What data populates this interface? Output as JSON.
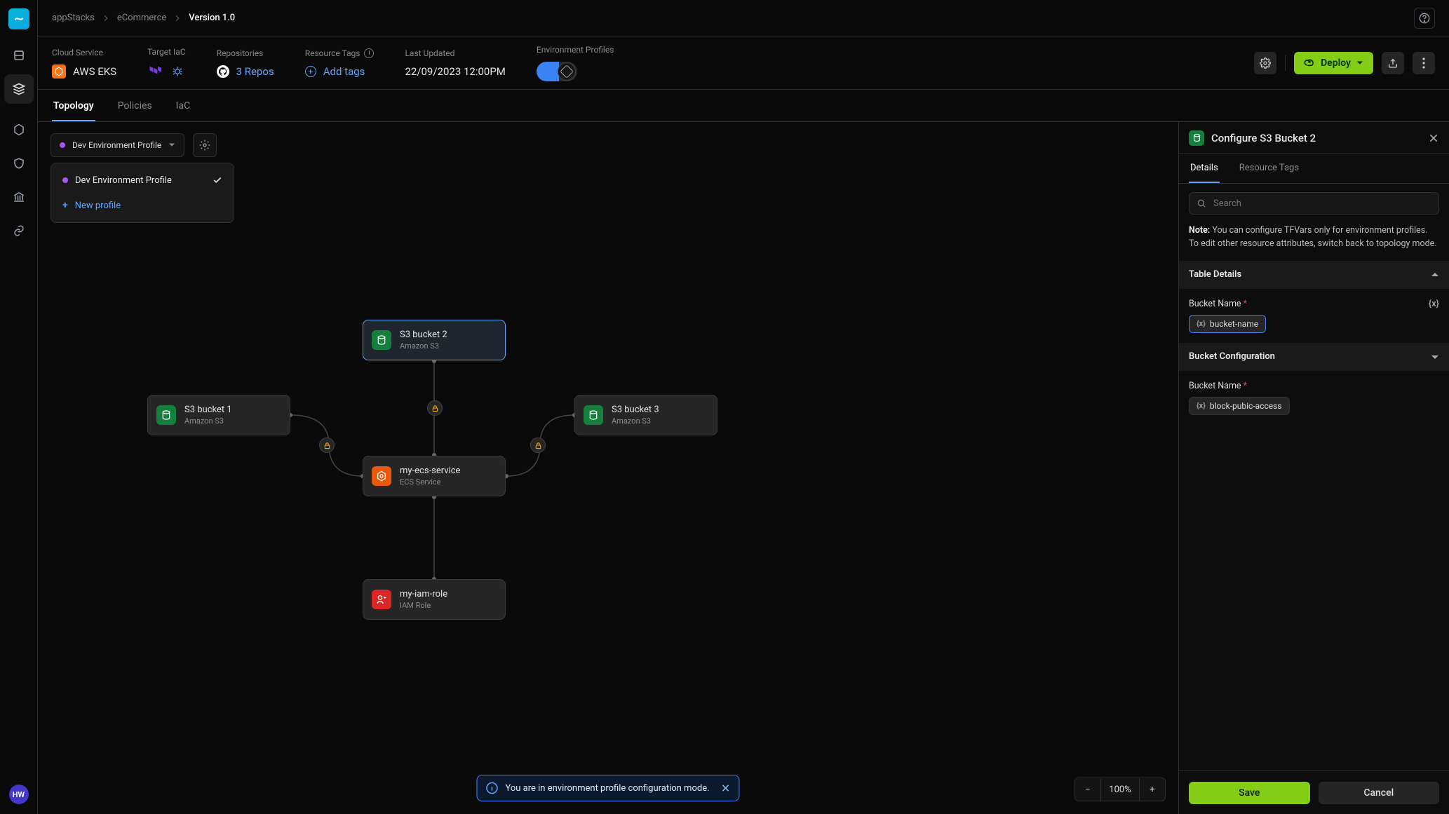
{
  "breadcrumbs": {
    "a": "appStacks",
    "b": "eCommerce",
    "c": "Version 1.0"
  },
  "header": {
    "cloud_label": "Cloud Service",
    "cloud_value": "AWS EKS",
    "iac_label": "Target IaC",
    "repo_label": "Repositories",
    "repo_value": "3 Repos",
    "tags_label": "Resource Tags",
    "tags_action": "Add tags",
    "updated_label": "Last Updated",
    "updated_value": "22/09/2023 12:00PM",
    "env_label": "Environment Profiles",
    "deploy_label": "Deploy"
  },
  "tabs": {
    "a": "Topology",
    "b": "Policies",
    "c": "IaC"
  },
  "profile_picker": {
    "current": "Dev Environment Profile",
    "menu_item": "Dev Environment Profile",
    "new": "New profile"
  },
  "nodes": {
    "s3a": {
      "title": "S3 bucket 2",
      "sub": "Amazon S3"
    },
    "s3b": {
      "title": "S3 bucket 1",
      "sub": "Amazon S3"
    },
    "s3c": {
      "title": "S3 bucket 3",
      "sub": "Amazon S3"
    },
    "ecs": {
      "title": "my-ecs-service",
      "sub": "ECS Service"
    },
    "iam": {
      "title": "my-iam-role",
      "sub": "IAM Role"
    }
  },
  "toast": "You are in environment profile configuration mode.",
  "zoom": "100%",
  "panel": {
    "title": "Configure S3 Bucket 2",
    "tabs": {
      "a": "Details",
      "b": "Resource Tags"
    },
    "search_ph": "Search",
    "note_b": "Note:",
    "note": " You can configure TFVars only for environment profiles. To edit other resource attributes, switch back to topology mode.",
    "sec1": "Table Details",
    "field1_label": "Bucket Name ",
    "field1_val": "bucket-name",
    "sec2": "Bucket Configuration",
    "field2_label": "Bucket Name ",
    "field2_val": "block-pubic-access",
    "save": "Save",
    "cancel": "Cancel",
    "vx": "{x}"
  },
  "avatar": "HW"
}
